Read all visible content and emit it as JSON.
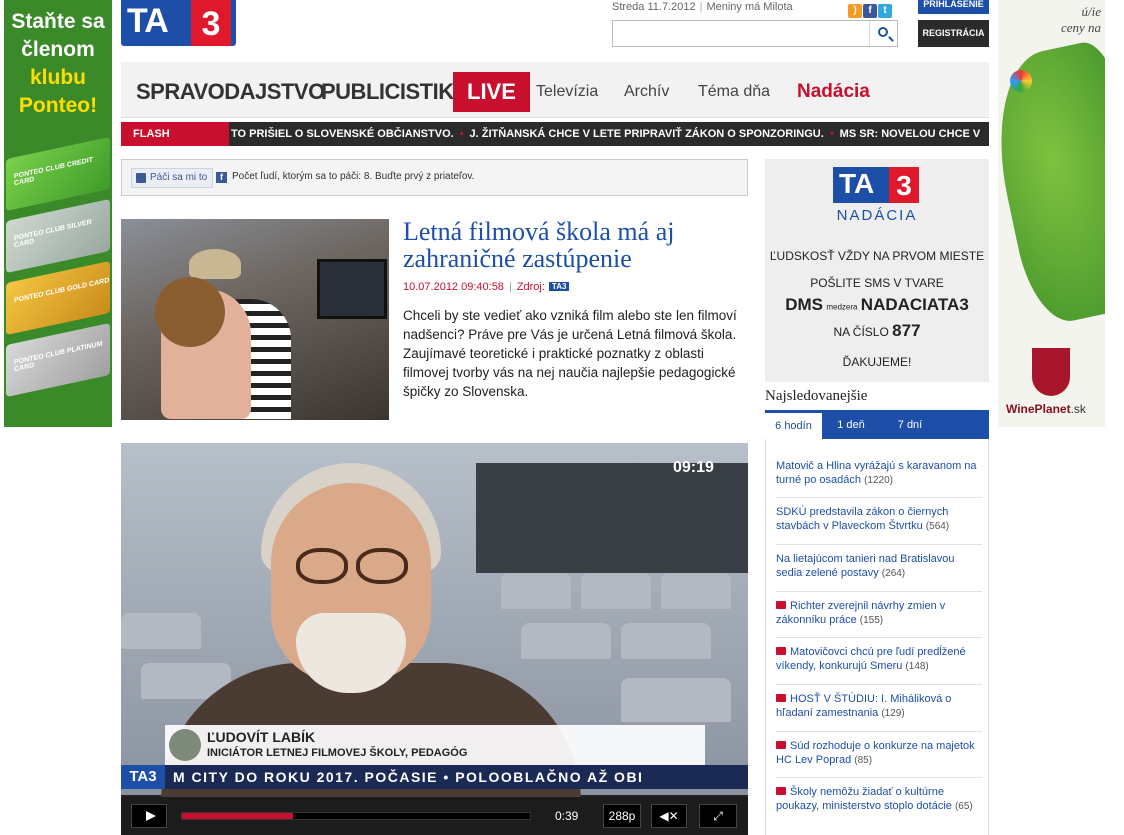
{
  "left_banner": {
    "line1": "Staňte sa",
    "line2": "členom",
    "line3": "klubu",
    "line4": "Ponteo!",
    "cards": [
      "PONTEO CLUB CREDIT CARD",
      "PONTEO CLUB SILVER CARD",
      "PONTEO CLUB GOLD CARD",
      "PONTEO CLUB PLATINUM CARD"
    ]
  },
  "right_banner": {
    "tagline": "ceny na",
    "tagline_top": "ú/ie",
    "brand": "WinePlanet",
    "brand_suffix": ".sk"
  },
  "header": {
    "logo_ta": "TA",
    "logo_3": "3",
    "date": "Streda 11.7.2012",
    "nameday": "Meniny má Milota",
    "login": "PRIHLÁSENIE",
    "register": "REGISTRÁCIA",
    "search_placeholder": ""
  },
  "nav": {
    "spravodajstvo": "SPRAVODAJSTVO",
    "publicistika": "PUBLICISTIKA",
    "live": "LIVE",
    "televizia": "Televízia",
    "archiv": "Archív",
    "tema": "Téma dňa",
    "nadacia": "Nadácia"
  },
  "flash": {
    "label": "FLASH SPRÁVY",
    "items": [
      "TO PRIŠIEL O SLOVENSKÉ OBČIANSTVO.",
      "J. ŽITŇANSKÁ CHCE V LETE PRIPRAVIŤ ZÁKON O SPONZORINGU.",
      "MS SR: NOVELOU CHCE V"
    ]
  },
  "likebox": {
    "button": "Páči sa mi to",
    "text": "Počet ľudí, ktorým sa to páči: 8. Buďte prvý z priateľov."
  },
  "article": {
    "title": "Letná filmová škola má aj zahraničné zastúpenie",
    "date": "10.07.2012 09:40:58",
    "source_label": "Zdroj:",
    "source": "TA3",
    "lead": "Chceli by ste vedieť ako vzniká film alebo ste len filmoví nadšenci? Práve pre Vás je určená Letná filmová škola. Zaujímavé teoretické i praktické poznatky z oblasti filmovej tvorby vás na nej naučia najlepšie pedagogické špičky zo Slovenska."
  },
  "video": {
    "clock": "09:19",
    "name": "ĽUDOVÍT LABÍK",
    "role": "INICIÁTOR LETNEJ FILMOVEJ ŠKOLY, PEDAGÓG",
    "ticker_logo": "TA3",
    "ticker": "M CITY DO ROKU 2017.   POČASIE   •   POLOOBLAČNO AŽ OBI",
    "time": "0:39",
    "quality": "288p",
    "progress": 0.32
  },
  "sidebar": {
    "nadacia_logo_ta": "TA",
    "nadacia_logo_3": "3",
    "nadacia_word": "NADÁCIA",
    "l1": "ĽUDSKOSŤ VŽDY NA PRVOM MIESTE",
    "l2": "POŠLITE SMS V TVARE",
    "l3a": "DMS",
    "l3b": "medzera",
    "l3c": "NADACIATA3",
    "l4a": "NA ČÍSLO",
    "l4b": "877",
    "l5": "ĎAKUJEME!",
    "most_read": "Najsledovanejšie",
    "tabs": [
      "6 hodín",
      "1 deň",
      "7 dní"
    ],
    "items": [
      {
        "text": "Matovič a Hlina vyrážajú s karavanom na turné po osadách",
        "count": "(1220)",
        "video": false
      },
      {
        "text": "SDKÚ predstavila zákon o čiernych stavbách v Plaveckom Štvrtku",
        "count": "(564)",
        "video": false
      },
      {
        "text": "Na lietajúcom tanieri nad Bratislavou sedia zelené postavy",
        "count": "(264)",
        "video": false
      },
      {
        "text": "Richter zverejnil návrhy zmien v zákonníku práce",
        "count": "(155)",
        "video": true
      },
      {
        "text": "Matovičovci chcú pre ľudí predĺžené víkendy, konkurujú Smeru",
        "count": "(148)",
        "video": true
      },
      {
        "text": "HOSŤ V ŠTÚDIU: I. Miháliková o hľadaní zamestnania",
        "count": "(129)",
        "video": true
      },
      {
        "text": "Súd rozhoduje o konkurze na majetok HC Lev Poprad",
        "count": "(85)",
        "video": true
      },
      {
        "text": "Školy nemôžu žiadať o kultúrne poukazy, ministerstvo stoplo dotácie",
        "count": "(65)",
        "video": true
      }
    ]
  }
}
